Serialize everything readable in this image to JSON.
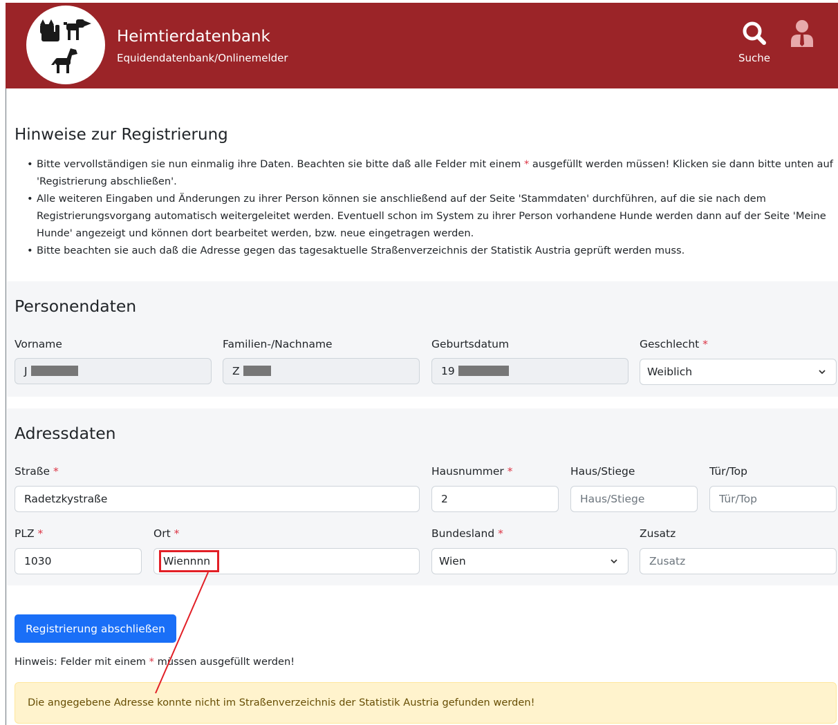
{
  "header": {
    "title": "Heimtierdatenbank",
    "subtitle": "Equidendatenbank/Onlinemelder",
    "search_label": "Suche",
    "search_icon": "search-icon",
    "user_icon": "user-icon",
    "logo_icons": [
      "cat-icon",
      "dog-icon",
      "horse-icon"
    ],
    "color": "#9b2428"
  },
  "notes": {
    "title": "Hinweise zur Registrierung",
    "item1_before": "Bitte vervollständigen sie nun einmalig ihre Daten. Beachten sie bitte daß alle Felder mit einem ",
    "required_mark": "*",
    "item1_after": " ausgefüllt werden müssen! Klicken sie dann bitte unten auf 'Registrierung abschließen'.",
    "item2": "Alle weiteren Eingaben und Änderungen zu ihrer Person können sie anschließend auf der Seite 'Stammdaten' durchführen, auf die sie nach dem Registrierungsvorgang automatisch weitergeleitet werden. Eventuell schon im System zu ihrer Person vorhandene Hunde werden dann auf der Seite 'Meine Hunde' angezeigt und können dort bearbeitet werden, bzw. neue eingetragen werden.",
    "item3": "Bitte beachten sie auch daß die Adresse gegen das tagesaktuelle Straßenverzeichnis der Statistik Austria geprüft werden muss."
  },
  "person": {
    "title": "Personendaten",
    "firstname_label": "Vorname",
    "firstname_value": "J",
    "lastname_label": "Familien-/Nachname",
    "lastname_value": "Z",
    "birthdate_label": "Geburtsdatum",
    "birthdate_value": "19",
    "gender_label": "Geschlecht",
    "gender_value": "Weiblich"
  },
  "address": {
    "title": "Adressdaten",
    "street_label": "Straße",
    "street_value": "Radetzkystraße",
    "housenumber_label": "Hausnummer",
    "housenumber_value": "2",
    "stair_label": "Haus/Stiege",
    "stair_placeholder": "Haus/Stiege",
    "door_label": "Tür/Top",
    "door_placeholder": "Tür/Top",
    "zip_label": "PLZ",
    "zip_value": "1030",
    "city_label": "Ort",
    "city_value": "Wiennnn",
    "state_label": "Bundesland",
    "state_value": "Wien",
    "extra_label": "Zusatz",
    "extra_placeholder": "Zusatz"
  },
  "submit_label": "Registrierung abschließen",
  "hint_before": "Hinweis: Felder mit einem ",
  "hint_after": " müssen ausgefüllt werden!",
  "alert_text": "Die angegebene Adresse konnte nicht im Straßenverzeichnis der Statistik Austria gefunden werden!",
  "colors": {
    "required": "#dc3545",
    "button": "#1a6ff7",
    "alert_bg": "#fff3cd",
    "annotation": "#e21f26"
  }
}
